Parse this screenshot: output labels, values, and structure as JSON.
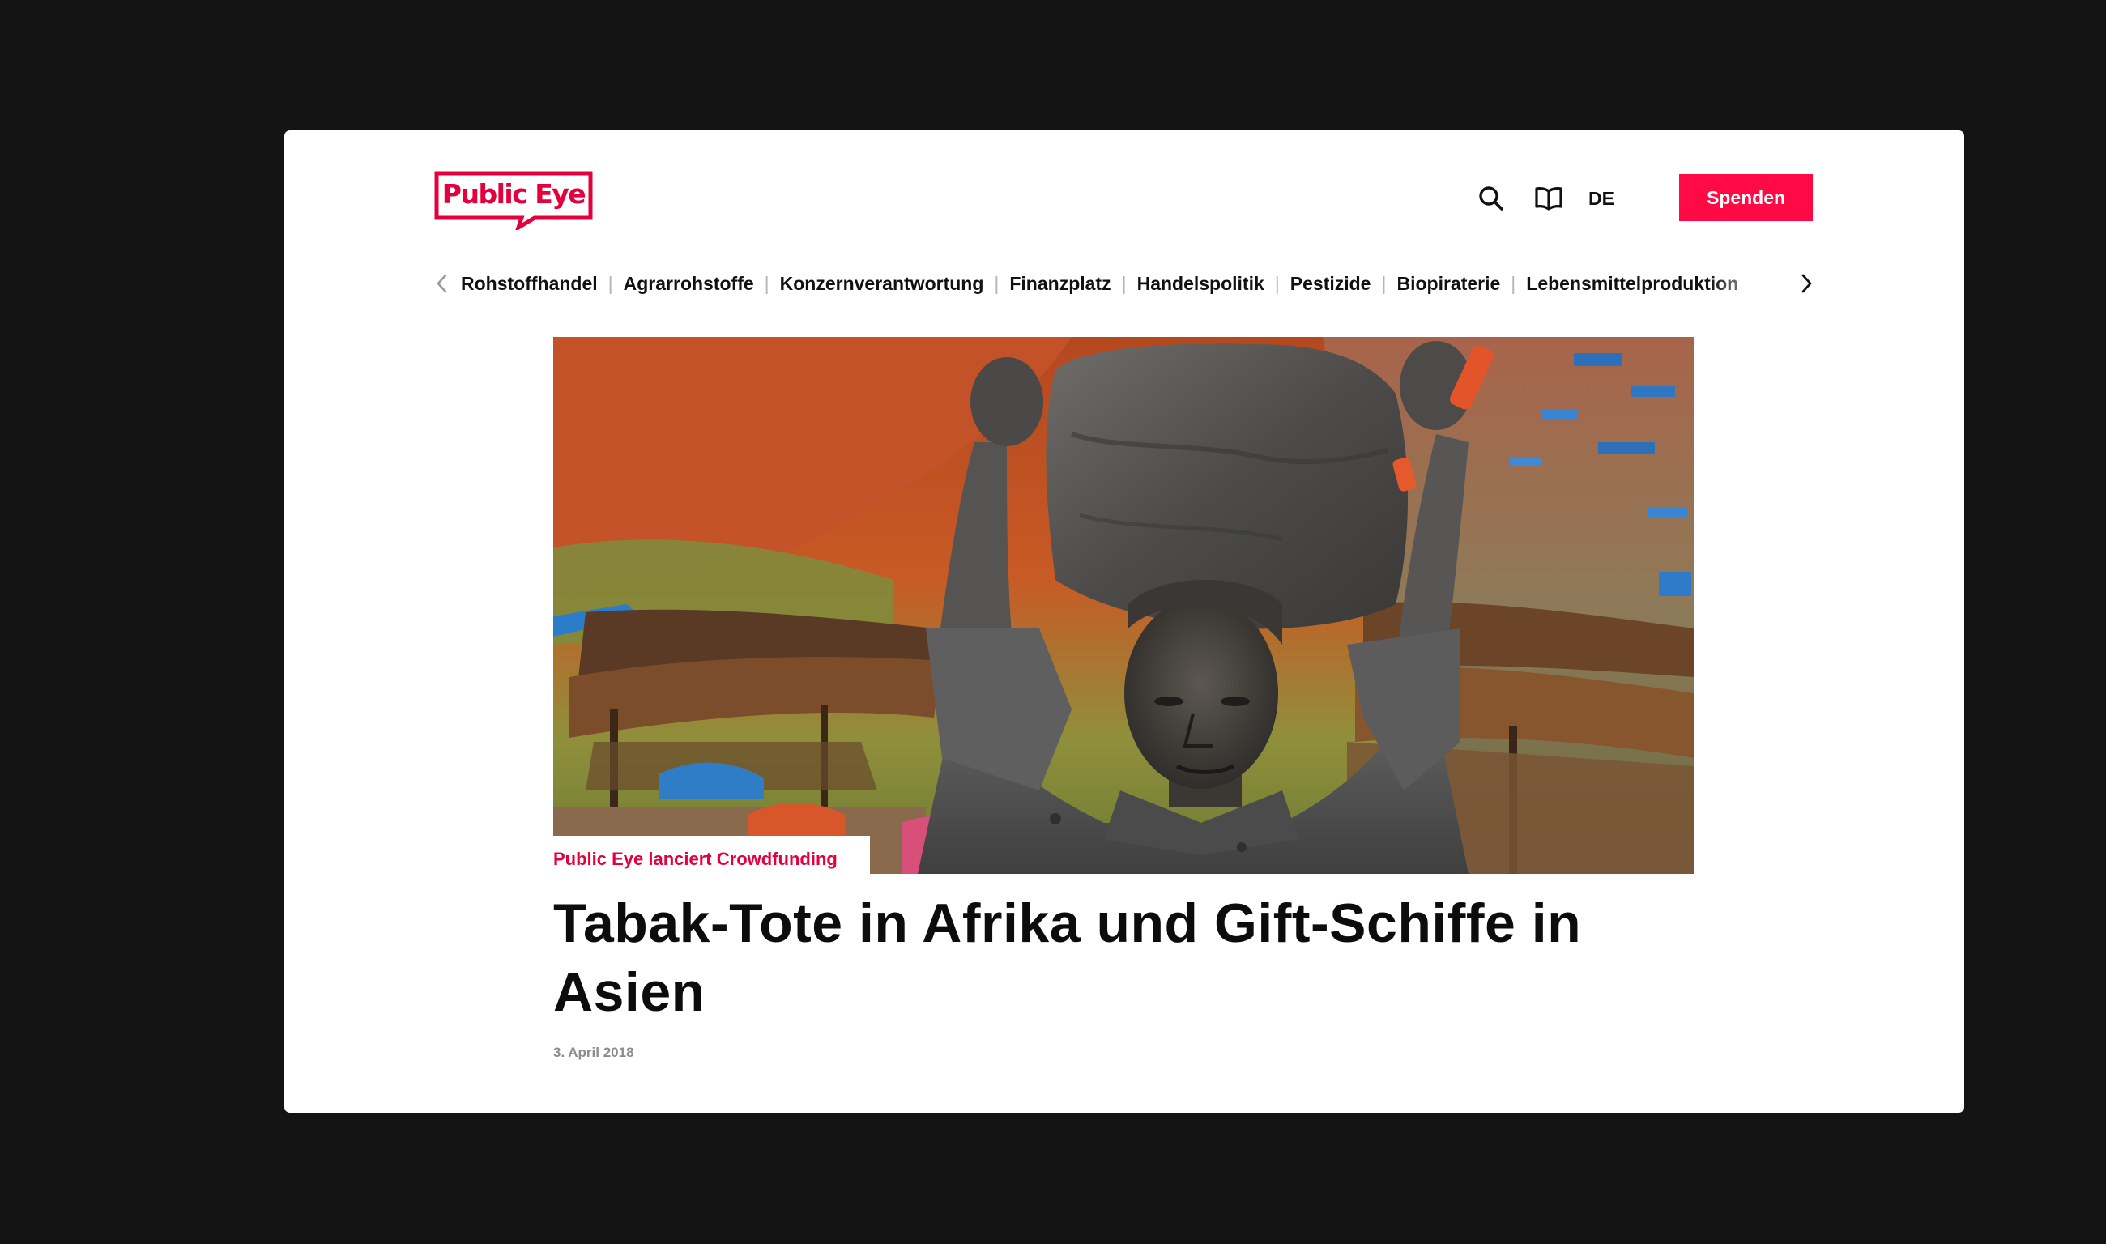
{
  "header": {
    "logo_text": "Public Eye",
    "language": "DE",
    "donate_label": "Spenden",
    "brand_color": "#e4003d",
    "button_color": "#ff0a44",
    "icons": [
      "search-icon",
      "book-icon"
    ]
  },
  "nav": {
    "items": [
      "Rohstoffhandel",
      "Agrarrohstoffe",
      "Konzernverantwortung",
      "Finanzplatz",
      "Handelspolitik",
      "Pestizide",
      "Biopiraterie",
      "Lebensmittelproduktion"
    ],
    "separator": "|",
    "prev_icon": "chevron-left-icon",
    "next_icon": "chevron-right-icon"
  },
  "article": {
    "kicker": "Public Eye lanciert Crowdfunding",
    "title": "Tabak-Tote in Afrika und Gift-Schiffe in Asien",
    "date": "3. April 2018"
  }
}
